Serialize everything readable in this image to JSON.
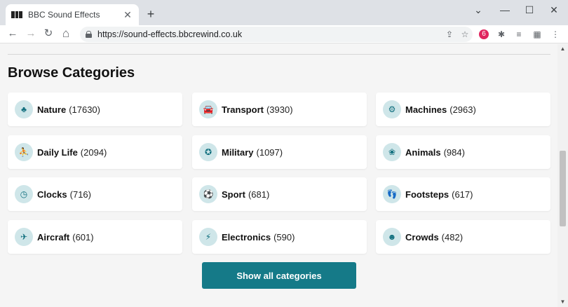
{
  "browser": {
    "tab_title": "BBC Sound Effects",
    "tab_close": "✕",
    "new_tab": "+",
    "minimize": "—",
    "maximize": "☐",
    "close": "✕",
    "url": "https://sound-effects.bbcrewind.co.uk"
  },
  "toolbar_icons": {
    "back": "←",
    "forward": "→",
    "reload": "↻",
    "home": "⌂",
    "share": "⇪",
    "star": "☆",
    "ext_red": "6",
    "puzzle": "✱",
    "media": "≡",
    "avatar": "▦",
    "menu": "⋮"
  },
  "page": {
    "heading": "Browse Categories",
    "show_all_label": "Show all categories",
    "categories": [
      {
        "name": "Nature",
        "count": "(17630)",
        "icon": "tree-icon",
        "glyph": "♣"
      },
      {
        "name": "Transport",
        "count": "(3930)",
        "icon": "car-icon",
        "glyph": "🚘"
      },
      {
        "name": "Machines",
        "count": "(2963)",
        "icon": "gear-icon",
        "glyph": "⚙"
      },
      {
        "name": "Daily Life",
        "count": "(2094)",
        "icon": "person-icon",
        "glyph": "⛹"
      },
      {
        "name": "Military",
        "count": "(1097)",
        "icon": "military-icon",
        "glyph": "✪"
      },
      {
        "name": "Animals",
        "count": "(984)",
        "icon": "paw-icon",
        "glyph": "❀"
      },
      {
        "name": "Clocks",
        "count": "(716)",
        "icon": "clock-icon",
        "glyph": "◷"
      },
      {
        "name": "Sport",
        "count": "(681)",
        "icon": "ball-icon",
        "glyph": "⚽"
      },
      {
        "name": "Footsteps",
        "count": "(617)",
        "icon": "footprints-icon",
        "glyph": "👣"
      },
      {
        "name": "Aircraft",
        "count": "(601)",
        "icon": "plane-icon",
        "glyph": "✈"
      },
      {
        "name": "Electronics",
        "count": "(590)",
        "icon": "lightning-icon",
        "glyph": "⚡"
      },
      {
        "name": "Crowds",
        "count": "(482)",
        "icon": "people-icon",
        "glyph": "☻"
      }
    ]
  },
  "colors": {
    "accent": "#157a88",
    "icon_bg": "#cfe6e9",
    "icon_fg": "#0f6e7d"
  }
}
